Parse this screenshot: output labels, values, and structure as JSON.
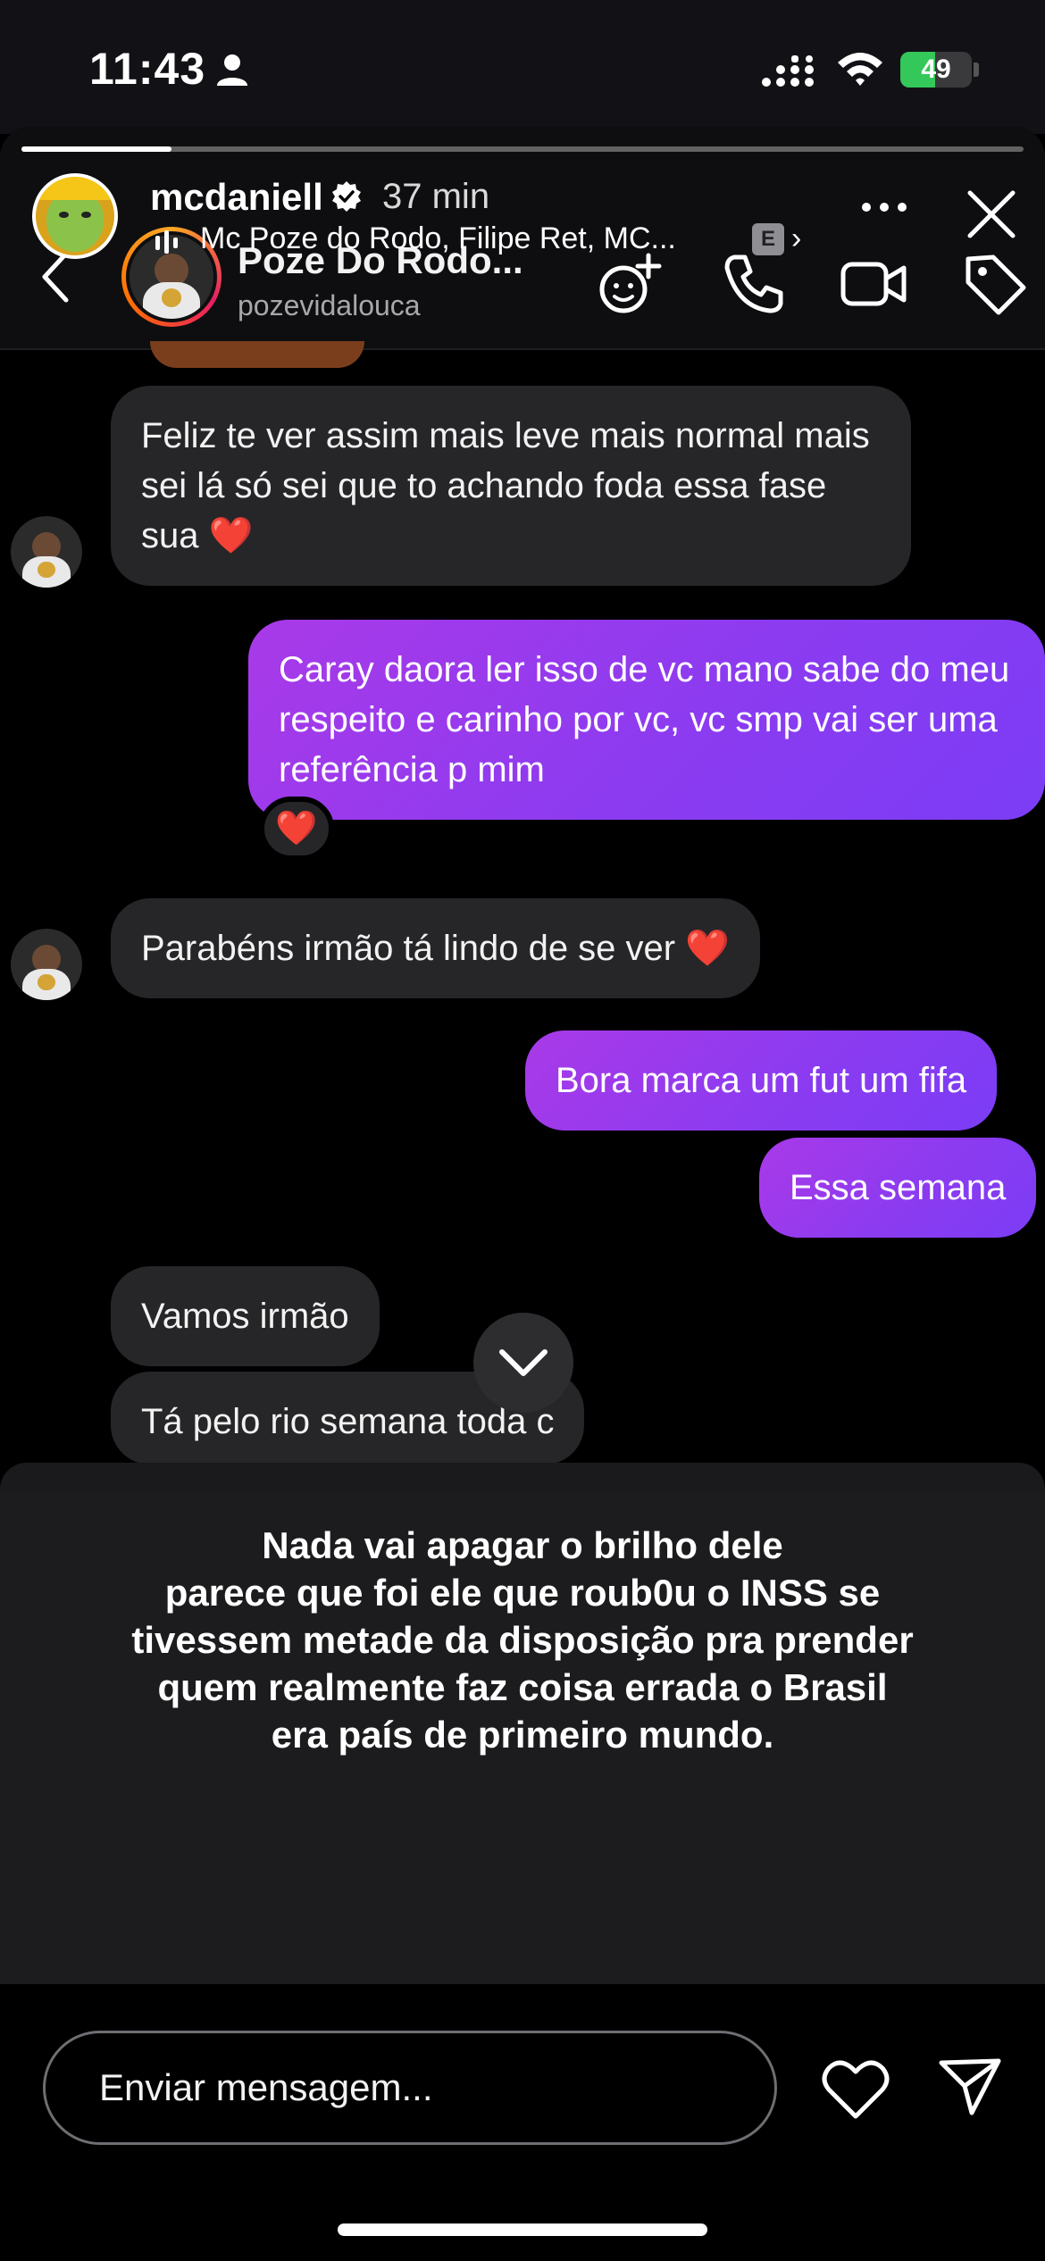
{
  "status_bar": {
    "time": "11:43",
    "battery": "49",
    "battery_level": 0.49
  },
  "story": {
    "progress": 0.15,
    "username": "mcdaniell",
    "time_ago": "37 min",
    "music": "Mc Poze do Rodo, Filipe Ret, MC...",
    "explicit": "E",
    "caption": "Nada vai apagar o brilho dele\nparece que foi ele que roub0u o INSS se\ntivessem metade da disposição pra prender\nquem realmente faz coisa errada o Brasil\nera país de primeiro mundo.",
    "reply_placeholder": "Enviar mensagem..."
  },
  "dm": {
    "name": "Poze Do Rodo...",
    "handle": "pozevidalouca",
    "messages": [
      {
        "from": "them",
        "text": "Feliz te ver assim mais leve mais normal mais sei lá só sei que to achando foda essa fase sua ❤️"
      },
      {
        "from": "me",
        "text": "Caray daora ler isso de vc mano sabe do meu respeito e carinho por vc, vc smp vai ser uma referência p mim",
        "reaction": "❤️"
      },
      {
        "from": "them",
        "text": "Parabéns irmão tá lindo de se ver ❤️"
      },
      {
        "from": "me",
        "text": "Bora marca um fut um fifa"
      },
      {
        "from": "me",
        "text": "Essa semana"
      },
      {
        "from": "them",
        "text": "Vamos irmão"
      },
      {
        "from": "them",
        "text": "Tá pelo rio semana toda c"
      }
    ]
  },
  "colors": {
    "outgoing_bubble": "#8c3bf0",
    "incoming_bubble": "#262628",
    "battery_green": "#34c759"
  },
  "icons": [
    "person-icon",
    "signal-icon",
    "wifi-icon",
    "verified-icon",
    "more-icon",
    "close-icon",
    "back-icon",
    "add-people-icon",
    "phone-icon",
    "video-icon",
    "tag-icon",
    "chevron-down-icon",
    "heart-icon",
    "send-icon"
  ]
}
